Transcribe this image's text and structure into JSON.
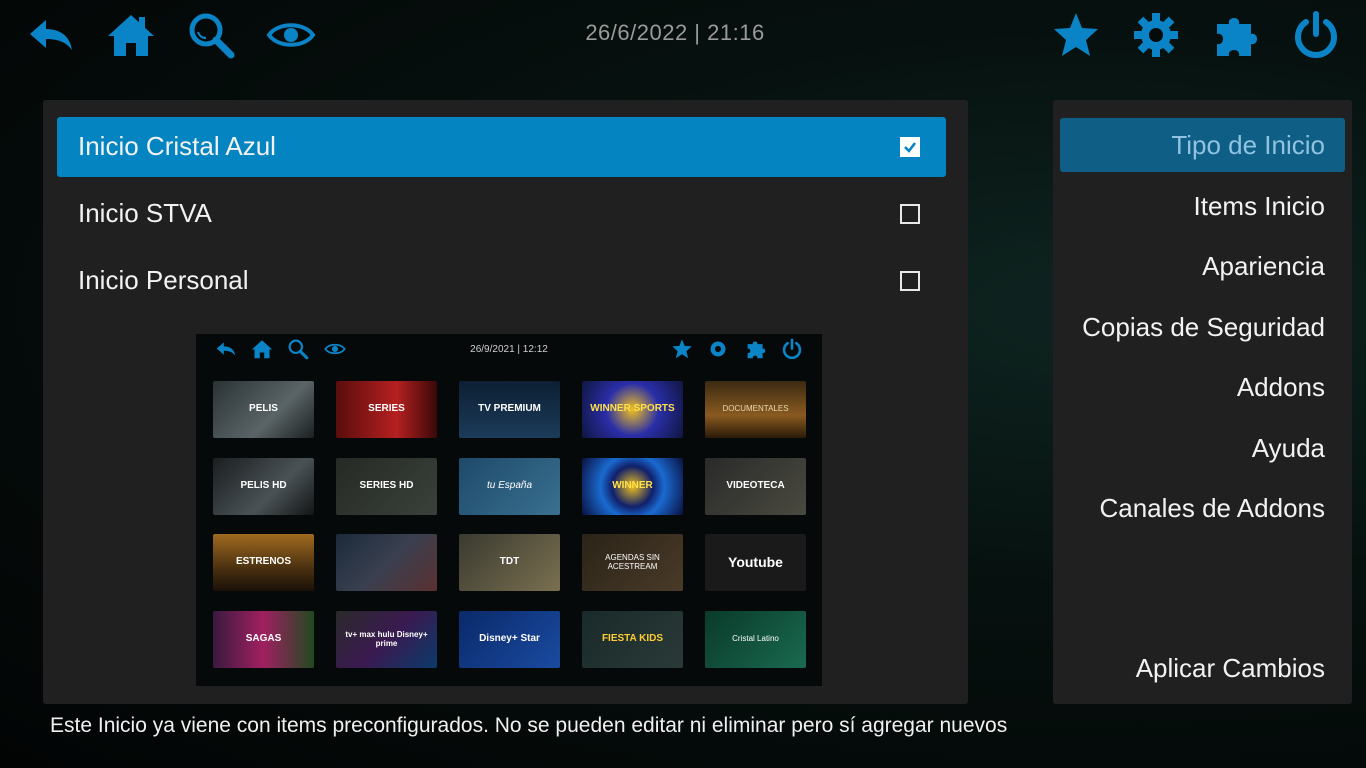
{
  "topbar": {
    "datetime": "26/6/2022 | 21:16",
    "left_icons": [
      "back-icon",
      "home-icon",
      "search-icon",
      "eye-icon"
    ],
    "right_icons": [
      "star-icon",
      "gear-icon",
      "puzzle-icon",
      "power-icon"
    ],
    "accent": "#0a84c6"
  },
  "options": [
    {
      "label": "Inicio Cristal Azul",
      "checked": true
    },
    {
      "label": "Inicio STVA",
      "checked": false
    },
    {
      "label": "Inicio Personal",
      "checked": false
    }
  ],
  "preview": {
    "datetime": "26/9/2021 | 12:12",
    "tiles": [
      [
        "PELIS",
        "SERIES",
        "TV PREMIUM",
        "WINNER SPORTS",
        "DOCUMENTALES"
      ],
      [
        "PELIS HD",
        "SERIES HD",
        "tu España",
        "WINNER",
        "VIDEOTECA"
      ],
      [
        "ESTRENOS",
        "",
        "TDT",
        "AGENDAS SIN ACESTREAM",
        "Youtube"
      ],
      [
        "SAGAS",
        "tv+ max hulu Disney+ prime",
        "Disney+ Star",
        "FIESTA KIDS",
        "Cristal Latino"
      ]
    ]
  },
  "sidebar": {
    "items": [
      {
        "label": "Tipo de Inicio",
        "active": true
      },
      {
        "label": "Items Inicio",
        "active": false
      },
      {
        "label": "Apariencia",
        "active": false
      },
      {
        "label": "Copias de Seguridad",
        "active": false
      },
      {
        "label": "Addons",
        "active": false
      },
      {
        "label": "Ayuda",
        "active": false
      },
      {
        "label": "Canales de Addons",
        "active": false
      }
    ],
    "apply_label": "Aplicar Cambios"
  },
  "footer_text": "Este Inicio ya viene con items preconfigurados. No se pueden editar ni eliminar pero sí agregar nuevos"
}
